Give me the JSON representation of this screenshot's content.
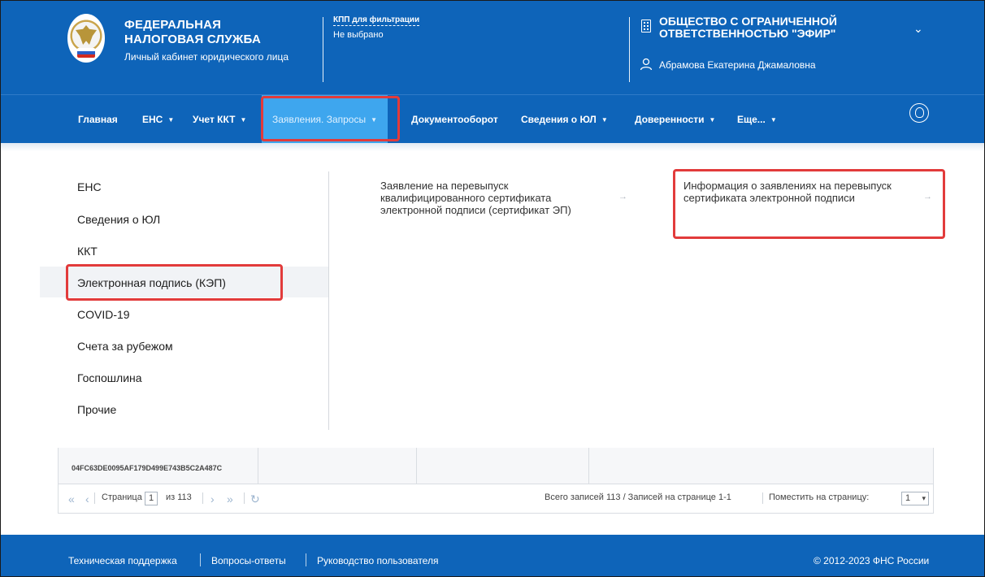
{
  "header": {
    "brand_title": "ФЕДЕРАЛЬНАЯ НАЛОГОВАЯ СЛУЖБА",
    "brand_subtitle": "Личный кабинет юридического лица",
    "kpp_label": "КПП для фильтрации",
    "kpp_value": "Не выбрано",
    "org_name": "ОБЩЕСТВО С ОГРАНИЧЕННОЙ ОТВЕТСТВЕННОСТЬЮ \"ЭФИР\"",
    "user_name": "Абрамова Екатерина Джамаловна"
  },
  "nav": {
    "items": [
      {
        "label": "Главная",
        "caret": false
      },
      {
        "label": "ЕНС",
        "caret": true
      },
      {
        "label": "Учет ККТ",
        "caret": true
      },
      {
        "label": "Заявления. Запросы",
        "caret": true,
        "active": true
      },
      {
        "label": "Документооборот",
        "caret": false
      },
      {
        "label": "Сведения о ЮЛ",
        "caret": true
      },
      {
        "label": "Доверенности",
        "caret": true
      },
      {
        "label": "Еще...",
        "caret": true
      }
    ],
    "caret_glyph": "▼"
  },
  "dropdown": {
    "categories": [
      "ЕНС",
      "Сведения о ЮЛ",
      "ККТ",
      "Электронная подпись (КЭП)",
      "COVID-19",
      "Счета за рубежом",
      "Госпошлина",
      "Прочие"
    ],
    "selected_category": "Электронная подпись (КЭП)",
    "links": [
      {
        "label": "Заявление на перевыпуск квалифицированного сертификата электронной подписи (сертификат ЭП)"
      },
      {
        "label": "Информация о заявлениях на перевыпуск сертификата электронной подписи"
      }
    ],
    "arrow_glyph": "→"
  },
  "table": {
    "hash": "04FC63DE0095AF179D499E743B5C2A487C"
  },
  "pager": {
    "page_label": "Страница",
    "page_value": "1",
    "of_label": "из 113",
    "summary": "Всего записей 113 / Записей на странице 1-1",
    "per_page_label": "Поместить на страницу:",
    "per_page_value": "1"
  },
  "footer": {
    "links": [
      "Техническая поддержка",
      "Вопросы-ответы",
      "Руководство пользователя"
    ],
    "copyright": "© 2012-2023 ФНС России"
  },
  "colors": {
    "header_bg": "#0e64b9",
    "active_tab_bg": "#3ea6ee",
    "highlight_red": "#e23b3b"
  }
}
